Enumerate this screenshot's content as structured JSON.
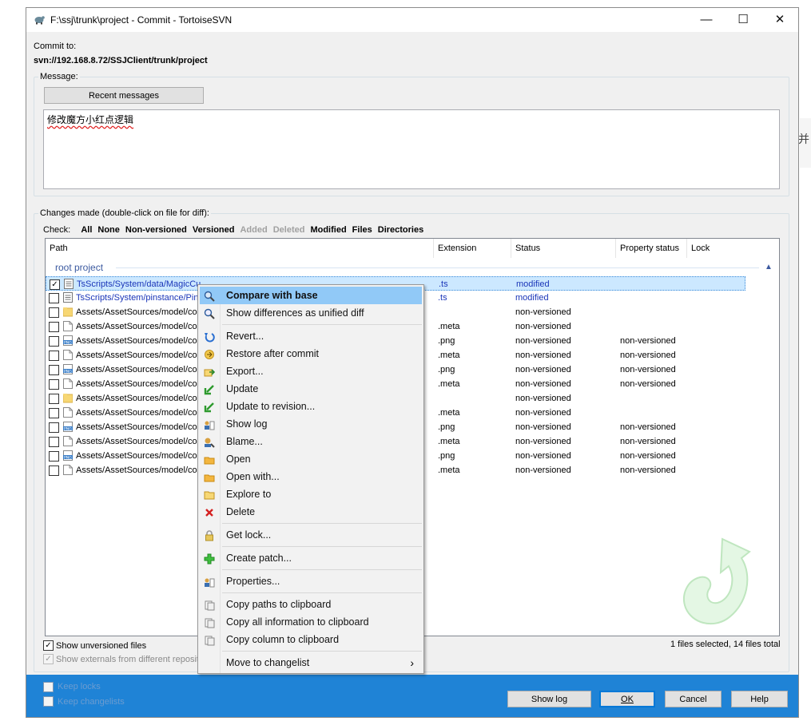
{
  "window": {
    "title": "F:\\ssj\\trunk\\project - Commit - TortoiseSVN",
    "minimize": "—",
    "maximize": "☐",
    "close": "✕"
  },
  "commit_to": {
    "label": "Commit to:",
    "url": "svn://192.168.8.72/SSJClient/trunk/project"
  },
  "message": {
    "group_label": "Message:",
    "recent_button": "Recent messages",
    "text": "修改魔方小红点逻辑"
  },
  "changes": {
    "group_label": "Changes made (double-click on file for diff):",
    "check_label": "Check:",
    "filters": [
      {
        "label": "All",
        "enabled": true
      },
      {
        "label": "None",
        "enabled": true
      },
      {
        "label": "Non-versioned",
        "enabled": true
      },
      {
        "label": "Versioned",
        "enabled": true
      },
      {
        "label": "Added",
        "enabled": false
      },
      {
        "label": "Deleted",
        "enabled": false
      },
      {
        "label": "Modified",
        "enabled": true
      },
      {
        "label": "Files",
        "enabled": true
      },
      {
        "label": "Directories",
        "enabled": true
      }
    ],
    "columns": [
      "Path",
      "Extension",
      "Status",
      "Property status",
      "Lock"
    ],
    "group_header": "root project",
    "rows": [
      {
        "checked": true,
        "icon": "text",
        "path": "TsScripts/System/data/MagicCubeData.ts",
        "ext": ".ts",
        "status": "modified",
        "prop": "",
        "mod": true,
        "selected": true
      },
      {
        "checked": false,
        "icon": "text",
        "path": "TsScripts/System/pinstance/PinstanceHallView.ts",
        "ext": ".ts",
        "status": "modified",
        "prop": "",
        "mod": true
      },
      {
        "checked": false,
        "icon": "folder",
        "path": "Assets/AssetSources/model/collection",
        "ext": "",
        "status": "non-versioned",
        "prop": ""
      },
      {
        "checked": false,
        "icon": "file",
        "path": "Assets/AssetSources/model/collection.meta",
        "ext": ".meta",
        "status": "non-versioned",
        "prop": ""
      },
      {
        "checked": false,
        "icon": "png",
        "path": "Assets/AssetSources/model/collection/1.png",
        "ext": ".png",
        "status": "non-versioned",
        "prop": "non-versioned"
      },
      {
        "checked": false,
        "icon": "file",
        "path": "Assets/AssetSources/model/collection/1.png.meta",
        "ext": ".meta",
        "status": "non-versioned",
        "prop": "non-versioned"
      },
      {
        "checked": false,
        "icon": "png",
        "path": "Assets/AssetSources/model/collection/2.png",
        "ext": ".png",
        "status": "non-versioned",
        "prop": "non-versioned"
      },
      {
        "checked": false,
        "icon": "file",
        "path": "Assets/AssetSources/model/collection/2.png.meta",
        "ext": ".meta",
        "status": "non-versioned",
        "prop": "non-versioned"
      },
      {
        "checked": false,
        "icon": "folder",
        "path": "Assets/AssetSources/model/collection/sub",
        "ext": "",
        "status": "non-versioned",
        "prop": ""
      },
      {
        "checked": false,
        "icon": "file",
        "path": "Assets/AssetSources/model/collection/sub.meta",
        "ext": ".meta",
        "status": "non-versioned",
        "prop": ""
      },
      {
        "checked": false,
        "icon": "png",
        "path": "Assets/AssetSources/model/collection/3.png",
        "ext": ".png",
        "status": "non-versioned",
        "prop": "non-versioned"
      },
      {
        "checked": false,
        "icon": "file",
        "path": "Assets/AssetSources/model/collection/3.png.meta",
        "ext": ".meta",
        "status": "non-versioned",
        "prop": "non-versioned"
      },
      {
        "checked": false,
        "icon": "png",
        "path": "Assets/AssetSources/model/collection/4.png",
        "ext": ".png",
        "status": "non-versioned",
        "prop": "non-versioned"
      },
      {
        "checked": false,
        "icon": "file",
        "path": "Assets/AssetSources/model/collection/4.png.meta",
        "ext": ".meta",
        "status": "non-versioned",
        "prop": "non-versioned"
      }
    ],
    "show_unversioned": "Show unversioned files",
    "show_externals": "Show externals from different repositories",
    "summary": "1 files selected, 14 files total"
  },
  "context_menu": {
    "items": [
      {
        "label": "Compare with base",
        "icon": "compare-icon",
        "highlight": true
      },
      {
        "label": "Show differences as unified diff",
        "icon": "diff-icon"
      },
      {
        "sep": true
      },
      {
        "label": "Revert...",
        "icon": "revert-icon"
      },
      {
        "label": "Restore after commit",
        "icon": "restore-icon"
      },
      {
        "label": "Export...",
        "icon": "export-icon"
      },
      {
        "label": "Update",
        "icon": "update-icon"
      },
      {
        "label": "Update to revision...",
        "icon": "update-revision-icon"
      },
      {
        "label": "Show log",
        "icon": "log-icon"
      },
      {
        "label": "Blame...",
        "icon": "blame-icon"
      },
      {
        "label": "Open",
        "icon": "open-icon"
      },
      {
        "label": "Open with...",
        "icon": "open-with-icon"
      },
      {
        "label": "Explore to",
        "icon": "folder-icon"
      },
      {
        "label": "Delete",
        "icon": "delete-icon"
      },
      {
        "sep": true
      },
      {
        "label": "Get lock...",
        "icon": "lock-icon"
      },
      {
        "sep": true
      },
      {
        "label": "Create patch...",
        "icon": "patch-icon"
      },
      {
        "sep": true
      },
      {
        "label": "Properties...",
        "icon": "properties-icon"
      },
      {
        "sep": true
      },
      {
        "label": "Copy paths to clipboard",
        "icon": "clipboard-icon"
      },
      {
        "label": "Copy all information to clipboard",
        "icon": "clipboard-icon"
      },
      {
        "label": "Copy column to clipboard",
        "icon": "clipboard-icon"
      },
      {
        "sep": true
      },
      {
        "label": "Move to changelist",
        "icon": "",
        "submenu": "›"
      }
    ]
  },
  "footer": {
    "keep_locks": "Keep locks",
    "keep_changelists": "Keep changelists",
    "show_log": "Show log",
    "ok": "OK",
    "cancel": "Cancel",
    "help": "Help"
  },
  "colors": {
    "accent": "#1f83d6",
    "highlight": "#91c9f7",
    "modified": "#1a35b8"
  },
  "background_glyph": "并"
}
